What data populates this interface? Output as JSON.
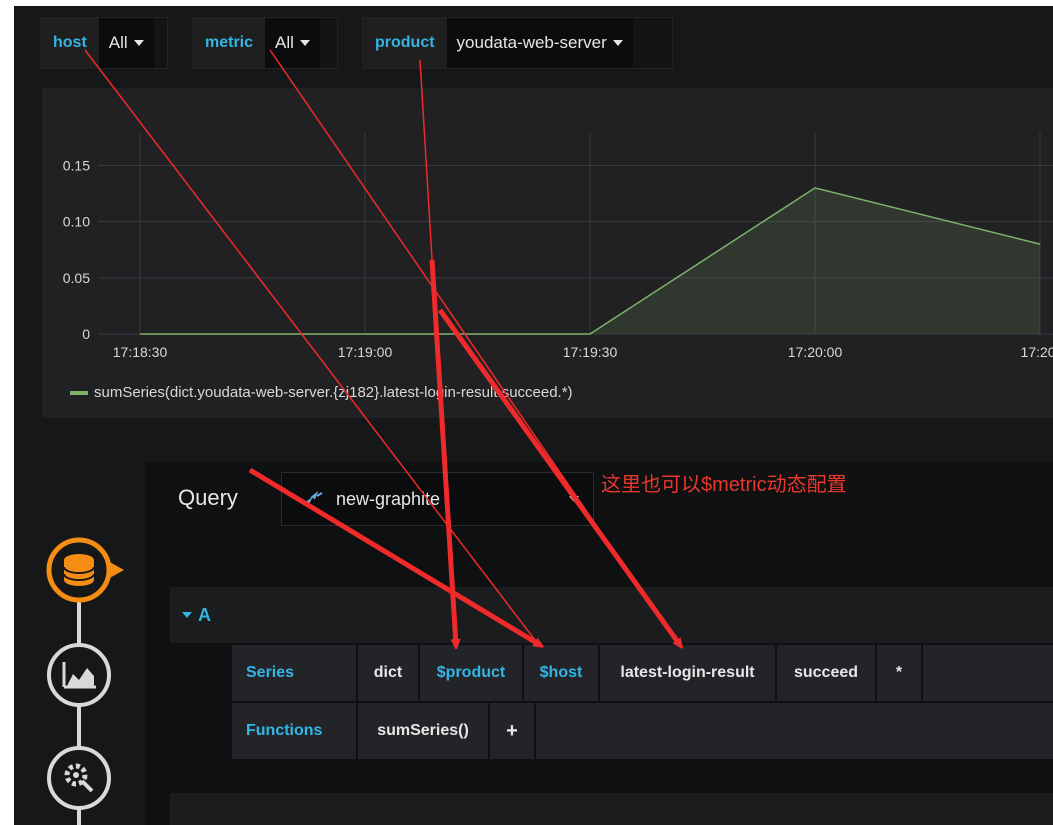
{
  "variables": [
    {
      "name": "host",
      "value": "All"
    },
    {
      "name": "metric",
      "value": "All"
    },
    {
      "name": "product",
      "value": "youdata-web-server"
    }
  ],
  "chart_data": {
    "type": "area",
    "x": [
      "17:18:30",
      "17:18:45",
      "17:19:00",
      "17:19:15",
      "17:19:30",
      "17:20:00",
      "17:20:30"
    ],
    "values": [
      0,
      0,
      0,
      0,
      0,
      0.13,
      0.08
    ],
    "xticks": [
      "17:18:30",
      "17:19:00",
      "17:19:30",
      "17:20:00",
      "17:20:"
    ],
    "yticks": [
      "0.15",
      "0.10",
      "0.05",
      "0"
    ],
    "ylim": [
      0,
      0.17
    ],
    "grid": true,
    "series_color": "#7eb26d",
    "legend": "sumSeries(dict.youdata-web-server.{zj182}.latest-login-result.succeed.*)",
    "legend_position": "bottom-left"
  },
  "query": {
    "label": "Query",
    "datasource": "new-graphite",
    "row_label": "A",
    "series_label": "Series",
    "series_segments": [
      "dict",
      "$product",
      "$host",
      "latest-login-result",
      "succeed",
      "*"
    ],
    "functions_label": "Functions",
    "functions": [
      "sumSeries()"
    ],
    "add_symbol": "+"
  },
  "annotation": "这里也可以$metric动态配置",
  "sidebar": {
    "icons": [
      "database-icon",
      "chart-icon",
      "settings-icon"
    ]
  },
  "colors": {
    "accent": "#33b5e5",
    "annotation": "#e8372b",
    "active_icon": "#f58c14",
    "background": "#161719"
  }
}
